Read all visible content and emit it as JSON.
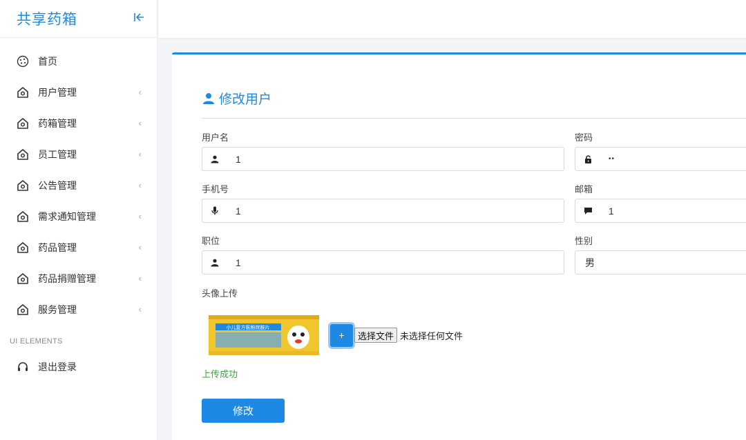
{
  "brand": {
    "title": "共享药箱"
  },
  "sidebar": {
    "items": [
      {
        "label": "首页",
        "icon": "cookie-icon",
        "has_submenu": false
      },
      {
        "label": "用户管理",
        "icon": "home-icon",
        "has_submenu": true
      },
      {
        "label": "药箱管理",
        "icon": "home-icon",
        "has_submenu": true
      },
      {
        "label": "员工管理",
        "icon": "home-icon",
        "has_submenu": true
      },
      {
        "label": "公告管理",
        "icon": "home-icon",
        "has_submenu": true
      },
      {
        "label": "需求通知管理",
        "icon": "home-icon",
        "has_submenu": true
      },
      {
        "label": "药品管理",
        "icon": "home-icon",
        "has_submenu": true
      },
      {
        "label": "药品捐赠管理",
        "icon": "home-icon",
        "has_submenu": true
      },
      {
        "label": "服务管理",
        "icon": "home-icon",
        "has_submenu": true
      }
    ],
    "section_label": "UI ELEMENTS",
    "logout": {
      "label": "退出登录",
      "icon": "headphones-icon"
    },
    "chevron": "‹"
  },
  "form": {
    "title": "修改用户",
    "username": {
      "label": "用户名",
      "value": "1",
      "icon": "user-icon"
    },
    "password": {
      "label": "密码",
      "value": "••",
      "icon": "lock-icon"
    },
    "phone": {
      "label": "手机号",
      "value": "1",
      "icon": "microphone-icon"
    },
    "email": {
      "label": "邮箱",
      "value": "1",
      "icon": "comment-icon"
    },
    "position": {
      "label": "职位",
      "value": "1",
      "icon": "user-icon"
    },
    "gender": {
      "label": "性别",
      "value": "男"
    },
    "avatar": {
      "label": "头像上传",
      "plus": "+",
      "choose_file": "选择文件",
      "no_file": "未选择任何文件",
      "success": "上传成功",
      "thumb_text": "小儿复方氨酚烷胺片"
    },
    "submit_label": "修改"
  },
  "colors": {
    "accent": "#1e88e5",
    "success": "#43a047"
  }
}
